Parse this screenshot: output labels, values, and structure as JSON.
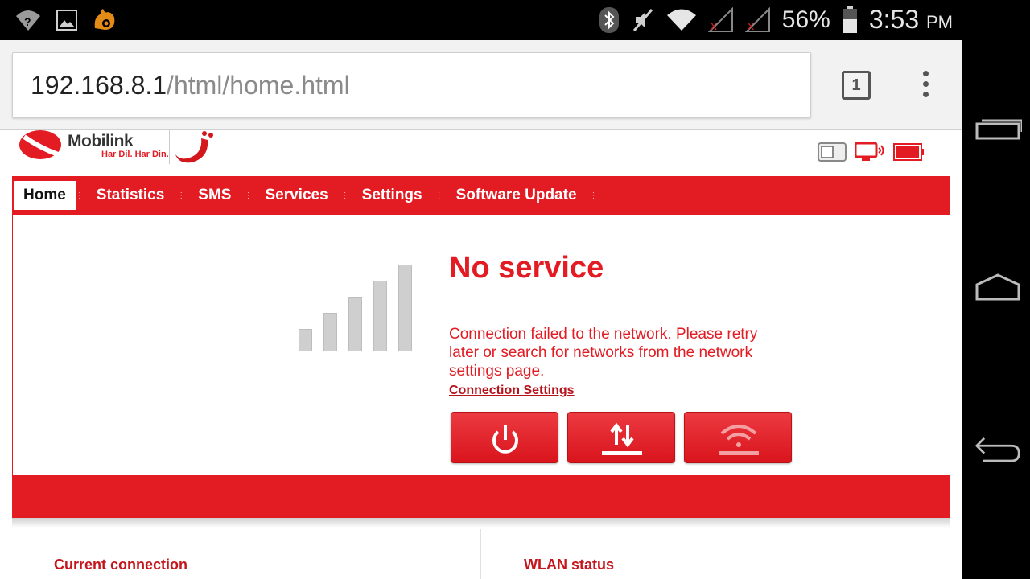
{
  "statusbar": {
    "battery_percent": "56%",
    "time": "3:53",
    "ampm": "PM"
  },
  "browser": {
    "url_host": "192.168.8.1",
    "url_path": "/html/home.html",
    "tab_count": "1"
  },
  "brand": {
    "name": "Mobilink",
    "tagline": "Har Dil. Har Din.",
    "accent": "#e31b23"
  },
  "menu": {
    "items": [
      "Home",
      "Statistics",
      "SMS",
      "Services",
      "Settings",
      "Software Update"
    ]
  },
  "status": {
    "title": "No service",
    "message": "Connection failed to the network. Please retry later or search for networks from the network settings page.",
    "link": "Connection Settings",
    "signal_bars": 5,
    "signal_level": 0
  },
  "actions": {
    "power_icon": "power-icon",
    "data_icon": "data-transfer-icon",
    "wifi_icon": "wifi-icon"
  },
  "sections": {
    "current_connection": "Current connection",
    "wlan_status": "WLAN status"
  }
}
